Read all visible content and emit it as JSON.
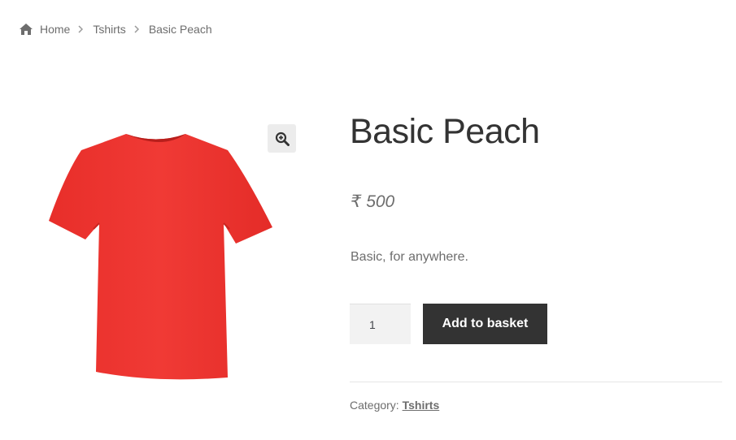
{
  "breadcrumb": {
    "items": [
      "Home",
      "Tshirts",
      "Basic Peach"
    ]
  },
  "product": {
    "title": "Basic Peach",
    "price": "₹ 500",
    "description": "Basic, for anywhere.",
    "quantity": "1",
    "add_to_basket_label": "Add to basket",
    "category_label": "Category:",
    "category_value": "Tshirts",
    "image_icon": "tshirt-image",
    "shirt_color": "#ee3530"
  },
  "icons": {
    "home": "home-icon",
    "zoom": "zoom-in-icon",
    "separator": "chevron-right-icon"
  },
  "colors": {
    "button_bg": "#333333",
    "text": "#6d6d6d"
  }
}
